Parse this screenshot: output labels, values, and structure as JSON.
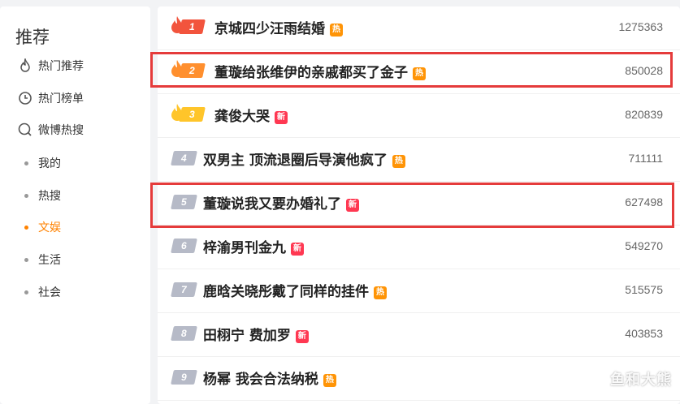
{
  "sidebar": {
    "title": "推荐",
    "nav": [
      {
        "label": "热门推荐",
        "icon": "flame-outline-icon"
      },
      {
        "label": "热门榜单",
        "icon": "clock-chart-icon"
      },
      {
        "label": "微博热搜",
        "icon": "search-circle-icon"
      }
    ],
    "sub": [
      {
        "label": "我的",
        "active": false
      },
      {
        "label": "热搜",
        "active": false
      },
      {
        "label": "文娱",
        "active": true
      },
      {
        "label": "生活",
        "active": false
      },
      {
        "label": "社会",
        "active": false
      }
    ]
  },
  "list": [
    {
      "rank": "1",
      "title": "京城四少汪雨结婚",
      "badge": "热",
      "badge_type": "hot",
      "count": "1275363",
      "flame": true
    },
    {
      "rank": "2",
      "title": "董璇给张维伊的亲戚都买了金子",
      "badge": "热",
      "badge_type": "hot",
      "count": "850028",
      "flame": true
    },
    {
      "rank": "3",
      "title": "龚俊大哭",
      "badge": "新",
      "badge_type": "new",
      "count": "820839",
      "flame": true
    },
    {
      "rank": "4",
      "title": "双男主 顶流退圈后导演他疯了",
      "badge": "热",
      "badge_type": "hot",
      "count": "711111",
      "flame": false
    },
    {
      "rank": "5",
      "title": "董璇说我又要办婚礼了",
      "badge": "新",
      "badge_type": "new",
      "count": "627498",
      "flame": false
    },
    {
      "rank": "6",
      "title": "梓渝男刊金九",
      "badge": "新",
      "badge_type": "new",
      "count": "549270",
      "flame": false
    },
    {
      "rank": "7",
      "title": "鹿晗关晓彤戴了同样的挂件",
      "badge": "热",
      "badge_type": "hot",
      "count": "515575",
      "flame": false
    },
    {
      "rank": "8",
      "title": "田栩宁 费加罗",
      "badge": "新",
      "badge_type": "new",
      "count": "403853",
      "flame": false
    },
    {
      "rank": "9",
      "title": "杨幂 我会合法纳税",
      "badge": "热",
      "badge_type": "hot",
      "count": "",
      "flame": false
    }
  ],
  "watermark": "鱼和大熊",
  "colors": {
    "accent": "#ff8200",
    "highlight": "#e53b3b",
    "hot_badge": "#ff9406",
    "new_badge": "#ff3852"
  }
}
